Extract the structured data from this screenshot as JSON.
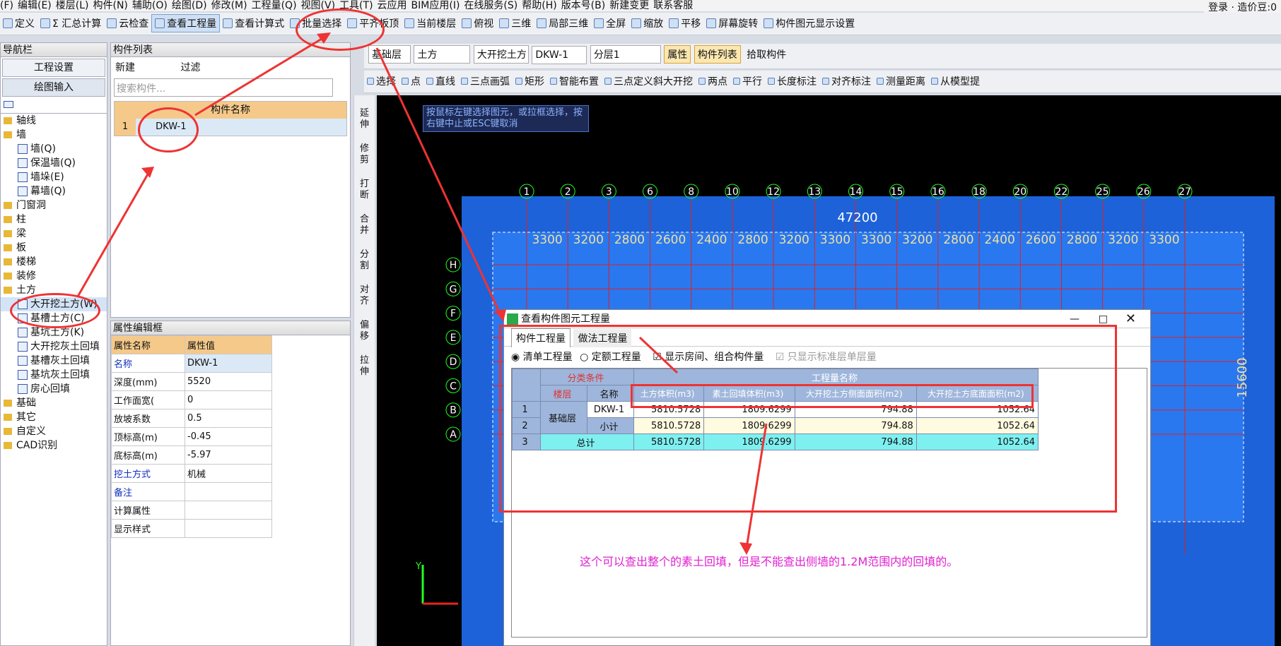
{
  "menu": [
    "(F)",
    "编辑(E)",
    "楼层(L)",
    "构件(N)",
    "辅助(O)",
    "绘图(D)",
    "修改(M)",
    "工程量(Q)",
    "视图(V)",
    "工具(T)",
    "云应用",
    "BIM应用(I)",
    "在线服务(S)",
    "帮助(H)",
    "版本号(B)",
    "新建变更",
    "联系客服"
  ],
  "menu_right": "登录 · 造价豆:0",
  "toolbar1": [
    "定义",
    "Σ 汇总计算",
    "云检查",
    "查看工程量",
    "查看计算式",
    "批量选择",
    "平齐板顶",
    "当前楼层",
    "俯视",
    "三维",
    "局部三维",
    "全屏",
    "缩放",
    "平移",
    "屏幕旋转",
    "构件图元显示设置"
  ],
  "toolbar2": {
    "layer": "基础层",
    "type": "土方",
    "sub": "大开挖土方",
    "comp": "DKW-1",
    "floor": "分层1",
    "btns": [
      "属性",
      "构件列表",
      "拾取构件"
    ]
  },
  "toolbar3": [
    "选择",
    "点",
    "直线",
    "三点画弧",
    "矩形",
    "智能布置",
    "三点定义斜大开挖",
    "两点",
    "平行",
    "长度标注",
    "对齐标注",
    "测量距离",
    "从模型提"
  ],
  "nav": {
    "title": "导航栏",
    "btn1": "工程设置",
    "btn2": "绘图输入",
    "tree": [
      "轴线",
      "墙",
      "墙(Q)",
      "保温墙(Q)",
      "墙垛(E)",
      "幕墙(Q)",
      "门窗洞",
      "柱",
      "梁",
      "板",
      "楼梯",
      "装修",
      "土方",
      "大开挖土方(W)",
      "基槽土方(C)",
      "基坑土方(K)",
      "大开挖灰土回填",
      "基槽灰土回填",
      "基坑灰土回填",
      "房心回填",
      "基础",
      "其它",
      "自定义",
      "CAD识别"
    ]
  },
  "complist": {
    "title": "构件列表",
    "new": "新建",
    "filter": "过滤",
    "search": "搜索构件...",
    "col": "构件名称",
    "rows": [
      {
        "n": "1",
        "name": "DKW-1"
      }
    ]
  },
  "props": {
    "title": "属性编辑框",
    "h1": "属性名称",
    "h2": "属性值",
    "rows": [
      [
        "名称",
        "DKW-1"
      ],
      [
        "深度(mm)",
        "5520"
      ],
      [
        "工作面宽(",
        "0"
      ],
      [
        "放坡系数",
        "0.5"
      ],
      [
        "顶标高(m)",
        "-0.45"
      ],
      [
        "底标高(m)",
        "-5.97"
      ],
      [
        "挖土方式",
        "机械"
      ],
      [
        "备注",
        ""
      ],
      [
        "计算属性",
        ""
      ],
      [
        "显示样式",
        ""
      ]
    ]
  },
  "side_tools": [
    "延伸",
    "修剪",
    "打断",
    "合并",
    "分割",
    "对齐",
    "偏移",
    "拉伸"
  ],
  "hint": "按鼠标左键选择图元，或拉框选择，按右键中止或ESC键取消",
  "axes_top": [
    "1",
    "2",
    "3",
    "6",
    "8",
    "10",
    "12",
    "13",
    "14",
    "15",
    "16",
    "18",
    "20",
    "22",
    "25",
    "26",
    "27"
  ],
  "axes_side": [
    "H",
    "G",
    "F",
    "E",
    "D",
    "C",
    "B",
    "A"
  ],
  "dims_top": "47200",
  "dims_row": [
    "3300",
    "3200",
    "2800",
    "2600",
    "2400",
    "2800",
    "3200",
    "3300",
    "3300",
    "3200",
    "2800",
    "2400",
    "2600",
    "2800",
    "3200",
    "3300"
  ],
  "dims_side": "15600",
  "dialog": {
    "title": "查看构件图元工程量",
    "tab1": "构件工程量",
    "tab2": "做法工程量",
    "r1": "清单工程量",
    "r2": "定额工程量",
    "c1": "显示房间、组合构件量",
    "c2": "只显示标准层单层量",
    "h_group": "分类条件",
    "h_qty": "工程量名称",
    "h_floor": "楼层",
    "h_name": "名称",
    "cols": [
      "土方体积(m3)",
      "素土回填体积(m3)",
      "大开挖土方侧面面积(m2)",
      "大开挖土方底面面积(m2)"
    ],
    "rows": [
      [
        "1",
        "基础层",
        "DKW-1",
        "5810.5728",
        "1809.6299",
        "794.88",
        "1052.64"
      ],
      [
        "2",
        "",
        "小计",
        "5810.5728",
        "1809.6299",
        "794.88",
        "1052.64"
      ],
      [
        "3",
        "总计",
        "",
        "5810.5728",
        "1809.6299",
        "794.88",
        "1052.64"
      ]
    ]
  },
  "note": "这个可以查出整个的素土回填，但是不能查出侧墙的1.2M范围内的回填的。",
  "accent": "#e8323c"
}
